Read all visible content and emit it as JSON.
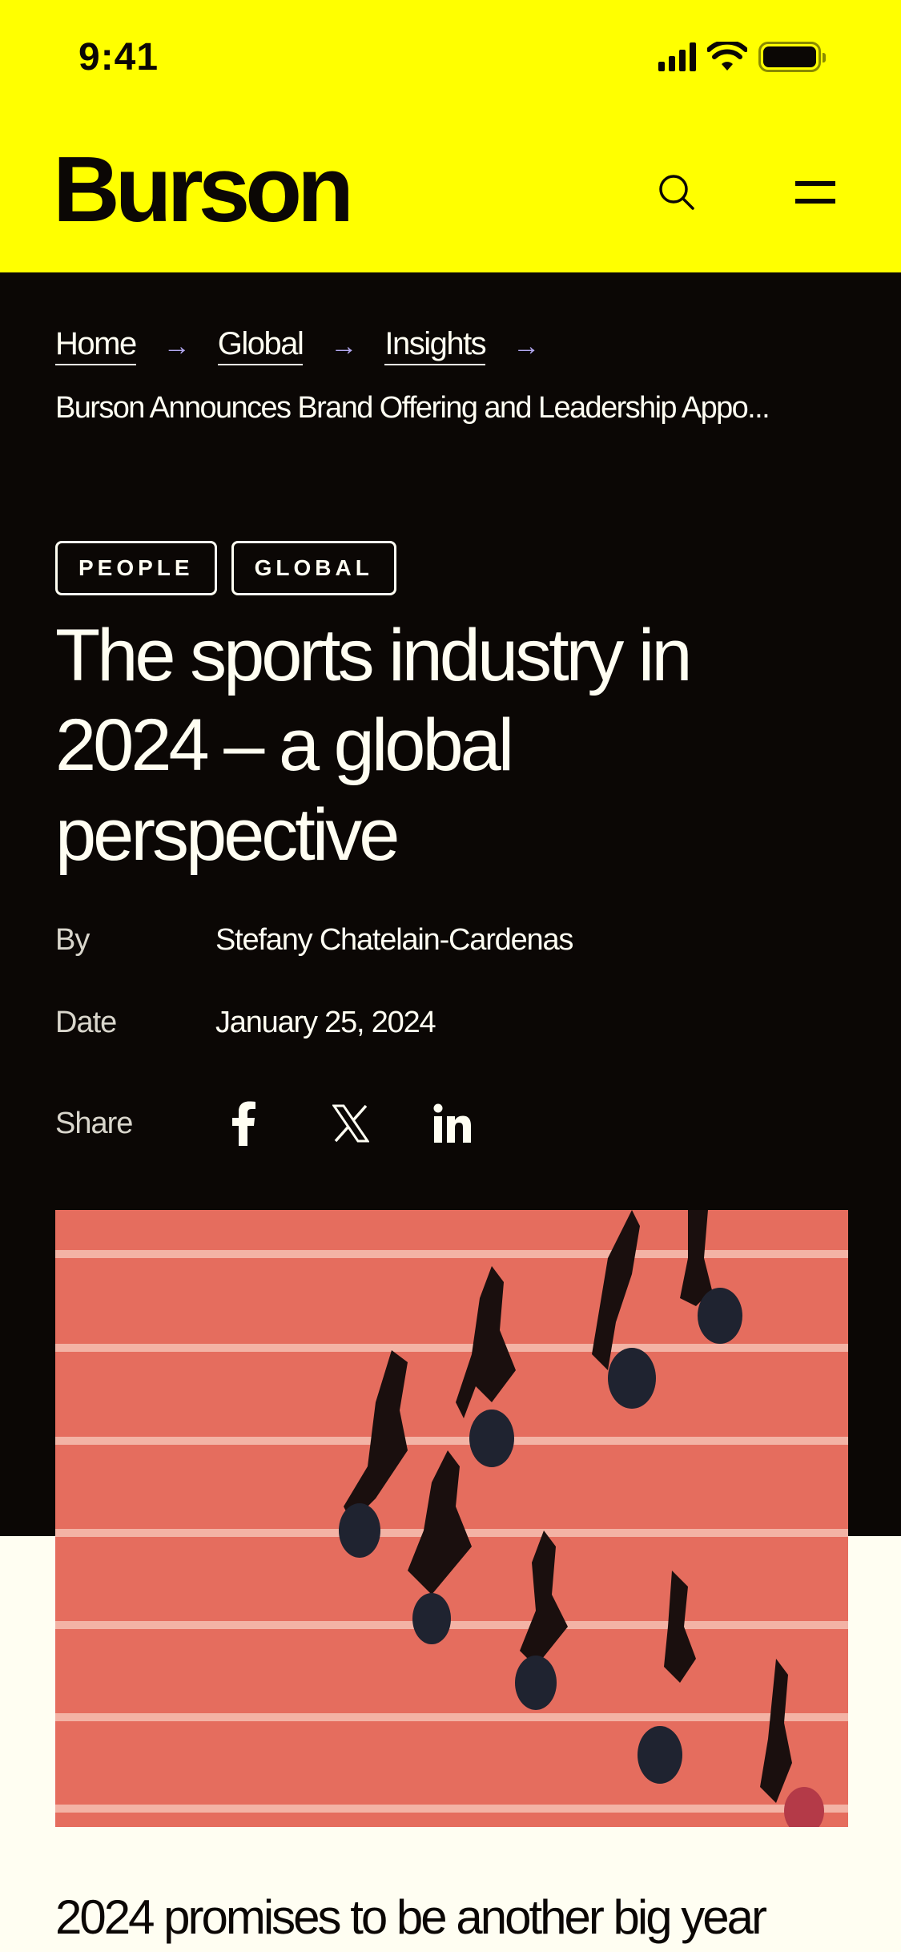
{
  "status_bar": {
    "time": "9:41",
    "icons": [
      "cellular-signal-icon",
      "wifi-icon",
      "battery-icon"
    ]
  },
  "header": {
    "logo": "Burson",
    "search_icon": "search-icon",
    "menu_icon": "hamburger-menu-icon",
    "background_color": "#FFFF00"
  },
  "breadcrumb": {
    "items": [
      {
        "label": "Home"
      },
      {
        "label": "Global"
      },
      {
        "label": "Insights"
      }
    ],
    "separator_icon": "arrow-right-icon",
    "current": "Burson Announces Brand Offering and Leadership Appo...",
    "arrow_color": "#B3A8F0"
  },
  "article": {
    "tags": [
      "PEOPLE",
      "GLOBAL"
    ],
    "title": "The sports industry in 2024 – a global perspective",
    "by_label": "By",
    "author": "Stefany Chatelain-Cardenas",
    "date_label": "Date",
    "date": "January 25, 2024",
    "share_label": "Share",
    "share_icons": [
      "facebook-icon",
      "x-twitter-icon",
      "linkedin-icon"
    ],
    "hero_image_alt": "Aerial view of runners and their shadows on a red running track",
    "intro_text": "2024 promises to be another big year"
  },
  "colors": {
    "dark_bg": "#0B0705",
    "cream_bg": "#FFFEF2",
    "track_red": "#E56D5E"
  }
}
